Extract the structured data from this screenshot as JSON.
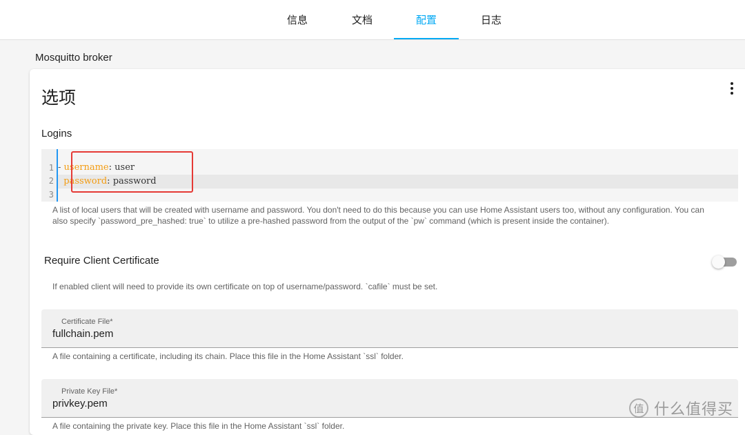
{
  "tabs": [
    {
      "label": "信息",
      "active": false
    },
    {
      "label": "文档",
      "active": false
    },
    {
      "label": "配置",
      "active": true
    },
    {
      "label": "日志",
      "active": false
    }
  ],
  "addon_name": "Mosquitto broker",
  "card": {
    "title": "选项",
    "logins": {
      "label": "Logins",
      "code": {
        "line_numbers": [
          "1",
          "2",
          "3"
        ],
        "lines": [
          {
            "prefix": "- ",
            "key": "username",
            "sep": ": ",
            "value": "user"
          },
          {
            "prefix": "  ",
            "key": "password",
            "sep": ": ",
            "value": "password"
          }
        ]
      },
      "description_line1": "A list of local users that will be created with username and password. You don't need to do this because you can use Home Assistant users too, without any configuration. You can",
      "description_line2": "also specify `password_pre_hashed: true` to utilize a pre-hashed password from the output of the `pw` command (which is present inside the container)."
    },
    "require_client_certificate": {
      "label": "Require Client Certificate",
      "enabled": false,
      "description": "If enabled client will need to provide its own certificate on top of username/password. `cafile` must be set."
    },
    "certificate_file": {
      "label": "Certificate File*",
      "value": "fullchain.pem",
      "description": "A file containing a certificate, including its chain. Place this file in the Home Assistant `ssl` folder."
    },
    "private_key_file": {
      "label": "Private Key File*",
      "value": "privkey.pem",
      "description": "A file containing the private key. Place this file in the Home Assistant `ssl` folder."
    }
  },
  "watermark": {
    "symbol": "值",
    "text": "什么值得买"
  },
  "colors": {
    "accent": "#03a9f4",
    "highlight_box": "#e53935",
    "yaml_key": "#f39c12"
  }
}
